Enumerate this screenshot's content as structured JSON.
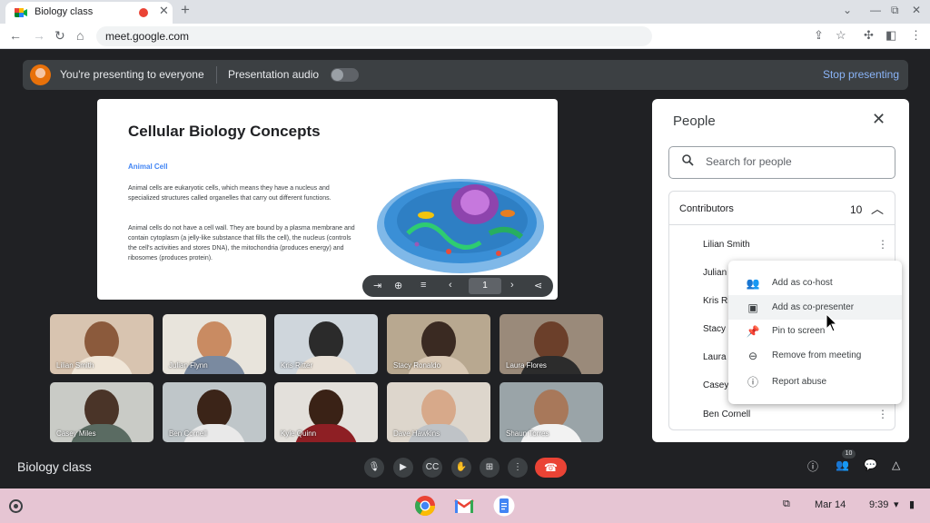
{
  "browser": {
    "tab_title": "Biology class",
    "url": "meet.google.com"
  },
  "banner": {
    "message": "You're presenting to everyone",
    "audio_label": "Presentation audio",
    "stop_label": "Stop presenting"
  },
  "slide": {
    "title": "Cellular Biology Concepts",
    "subtitle": "Animal Cell",
    "para1": "Animal cells are eukaryotic cells, which means they have a nucleus and specialized structures called organelles that carry out different functions.",
    "para2": "Animal cells do not have a cell wall. They are bound by a plasma membrane and contain cytoplasm (a jelly-like substance that fills the cell), the nucleus (controls the cell's activities and stores DNA), the mitochondria (produces energy) and ribosomes (produces protein).",
    "page": "1"
  },
  "participants": [
    {
      "name": "Lilian Smith"
    },
    {
      "name": "Julian Flynn"
    },
    {
      "name": "Kris Ritter"
    },
    {
      "name": "Stacy Ronaldo"
    },
    {
      "name": "Laura Flores"
    },
    {
      "name": "Casey Miles"
    },
    {
      "name": "Ben Cornell"
    },
    {
      "name": "Kyle Quinn"
    },
    {
      "name": "Dave Hawkins"
    },
    {
      "name": "Shaun Torres"
    }
  ],
  "people_panel": {
    "title": "People",
    "search_placeholder": "Search for people",
    "section_label": "Contributors",
    "count": "10",
    "rows": [
      "Lilian Smith",
      "Julian",
      "Kris Ri",
      "Stacy",
      "Laura",
      "Casey",
      "Ben Cornell"
    ]
  },
  "context_menu": {
    "items": [
      {
        "label": "Add as co-host",
        "icon": "co-host-icon"
      },
      {
        "label": "Add as co-presenter",
        "icon": "co-presenter-icon"
      },
      {
        "label": "Pin to screen",
        "icon": "pin-icon"
      },
      {
        "label": "Remove from meeting",
        "icon": "remove-icon"
      },
      {
        "label": "Report abuse",
        "icon": "report-icon"
      }
    ]
  },
  "meeting": {
    "name": "Biology class",
    "people_badge": "10"
  },
  "shelf": {
    "date": "Mar 14",
    "time": "9:39"
  },
  "colors": {
    "accent": "#8ab4f8",
    "end_call": "#ea4335",
    "background": "#202124"
  }
}
